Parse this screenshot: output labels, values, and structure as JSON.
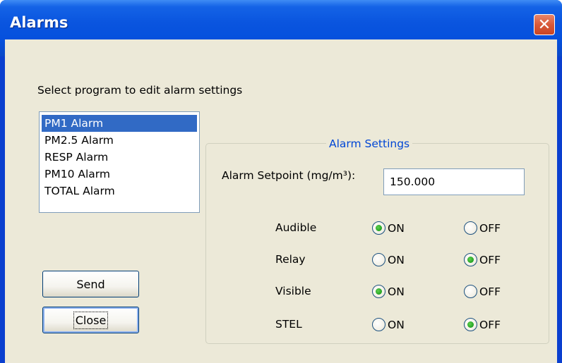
{
  "window": {
    "title": "Alarms",
    "close_glyph": "✕"
  },
  "prompt": "Select program to edit alarm settings",
  "programs": {
    "items": [
      "PM1 Alarm",
      "PM2.5 Alarm",
      "RESP Alarm",
      "PM10 Alarm",
      "TOTAL Alarm"
    ],
    "selected_index": 0
  },
  "buttons": {
    "send_label": "Send",
    "close_label": "Close"
  },
  "alarm_settings": {
    "title": "Alarm Settings",
    "setpoint_label": "Alarm Setpoint (mg/m³):",
    "setpoint_value": "150.000",
    "on_label": "ON",
    "off_label": "OFF",
    "rows": [
      {
        "label": "Audible",
        "value": "ON"
      },
      {
        "label": "Relay",
        "value": "OFF"
      },
      {
        "label": "Visible",
        "value": "ON"
      },
      {
        "label": "STEL",
        "value": "OFF"
      }
    ]
  },
  "colors": {
    "title_bar": "#0550dd",
    "dialog_bg": "#ece9d8",
    "selection": "#316ac5",
    "group_title": "#0046d5",
    "radio_dot": "#21a121"
  }
}
